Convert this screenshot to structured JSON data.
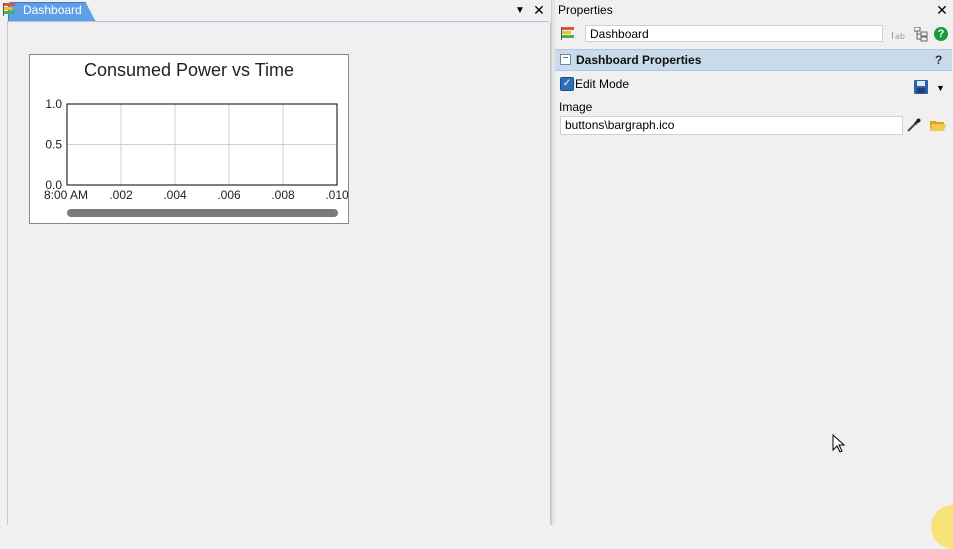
{
  "left_tab": {
    "label": "Dashboard"
  },
  "chart_widget": {
    "chart_data": {
      "type": "line",
      "title": "Consumed Power vs Time",
      "xlabel": "",
      "ylabel": "",
      "x_tick_labels": [
        "8:00 AM",
        ".002",
        ".004",
        ".006",
        ".008",
        ".010"
      ],
      "y_tick_labels": [
        "1.0",
        "0.5",
        "0.0"
      ],
      "ylim": [
        0.0,
        1.0
      ],
      "grid": true,
      "series": []
    }
  },
  "properties": {
    "title": "Properties",
    "object_name": "Dashboard",
    "toolbar_icons": [
      "label-icon",
      "tree-icon",
      "help-icon"
    ],
    "section_title": "Dashboard Properties",
    "section_help": "?",
    "edit_mode_label": "Edit Mode",
    "edit_mode_checked": true,
    "image_label": "Image",
    "image_value": "buttons\\bargraph.ico"
  },
  "colors": {
    "tab_active": "#5f9fe6",
    "section_header": "#c9daea",
    "help_green": "#1a9a3a",
    "checkbox_blue": "#2f6fb8"
  }
}
